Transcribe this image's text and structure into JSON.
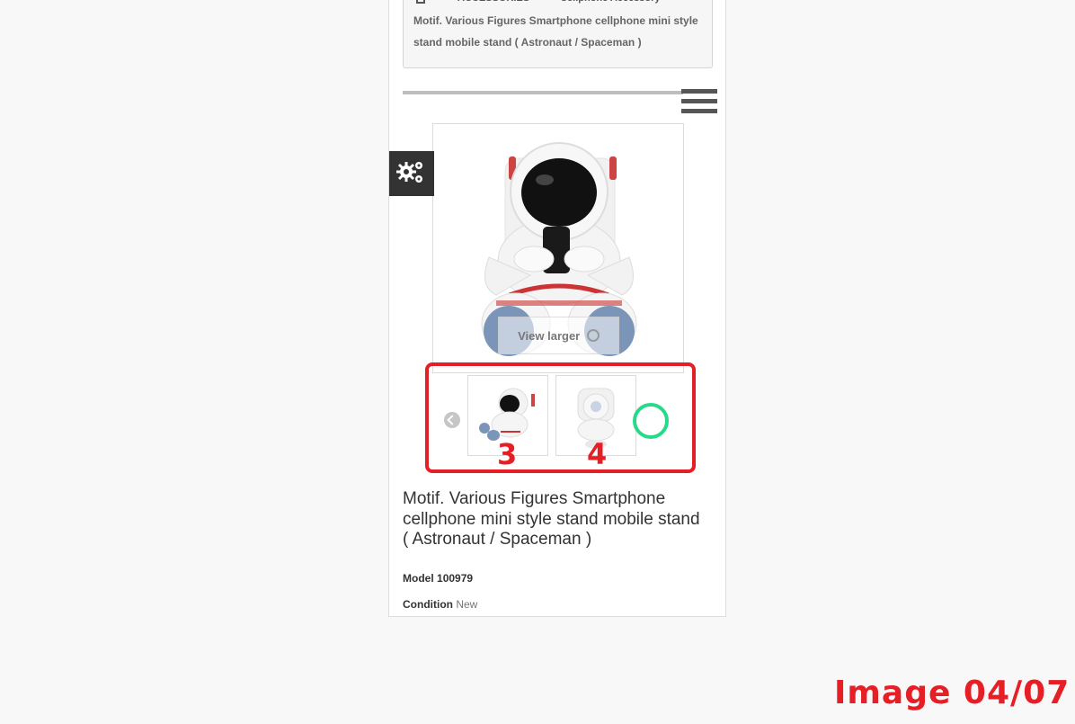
{
  "breadcrumb": {
    "items": [
      "ACCESSORIES",
      "Cellphone Accessory"
    ],
    "current": "Motif. Various Figures Smartphone cellphone mini style stand mobile stand ( Astronaut / Spaceman )"
  },
  "main_image": {
    "view_larger_label": "View larger"
  },
  "thumbnails": [
    {
      "number": "3"
    },
    {
      "number": "4"
    }
  ],
  "product": {
    "title": "Motif. Various Figures Smartphone cellphone mini style stand mobile stand ( Astronaut / Spaceman )",
    "model_label": "Model",
    "model_value": "100979",
    "condition_label": "Condition",
    "condition_value": "New"
  },
  "overlay": {
    "watermark": "Image 04/07"
  },
  "colors": {
    "annotation_red": "#e61f26",
    "annotation_green": "#27d98a",
    "settings_bg": "#333333"
  },
  "icons": [
    "home-icon",
    "menu-icon",
    "settings-gears-icon",
    "zoom-icon",
    "chevron-left-icon"
  ]
}
